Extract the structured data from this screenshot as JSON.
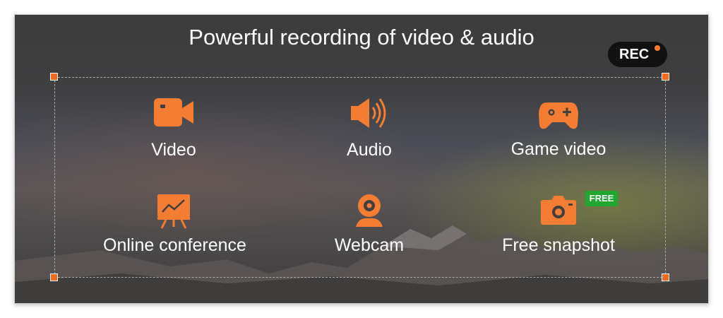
{
  "header": {
    "title": "Powerful recording of video & audio"
  },
  "rec_badge": {
    "label": "REC"
  },
  "accent_color": "#f57c33",
  "features": [
    {
      "label": "Video",
      "icon": "video-camera-icon"
    },
    {
      "label": "Audio",
      "icon": "speaker-icon"
    },
    {
      "label": "Game video",
      "icon": "gamepad-icon"
    },
    {
      "label": "Online conference",
      "icon": "presentation-board-icon"
    },
    {
      "label": "Webcam",
      "icon": "webcam-icon"
    },
    {
      "label": "Free snapshot",
      "icon": "camera-icon",
      "badge": "FREE"
    }
  ]
}
